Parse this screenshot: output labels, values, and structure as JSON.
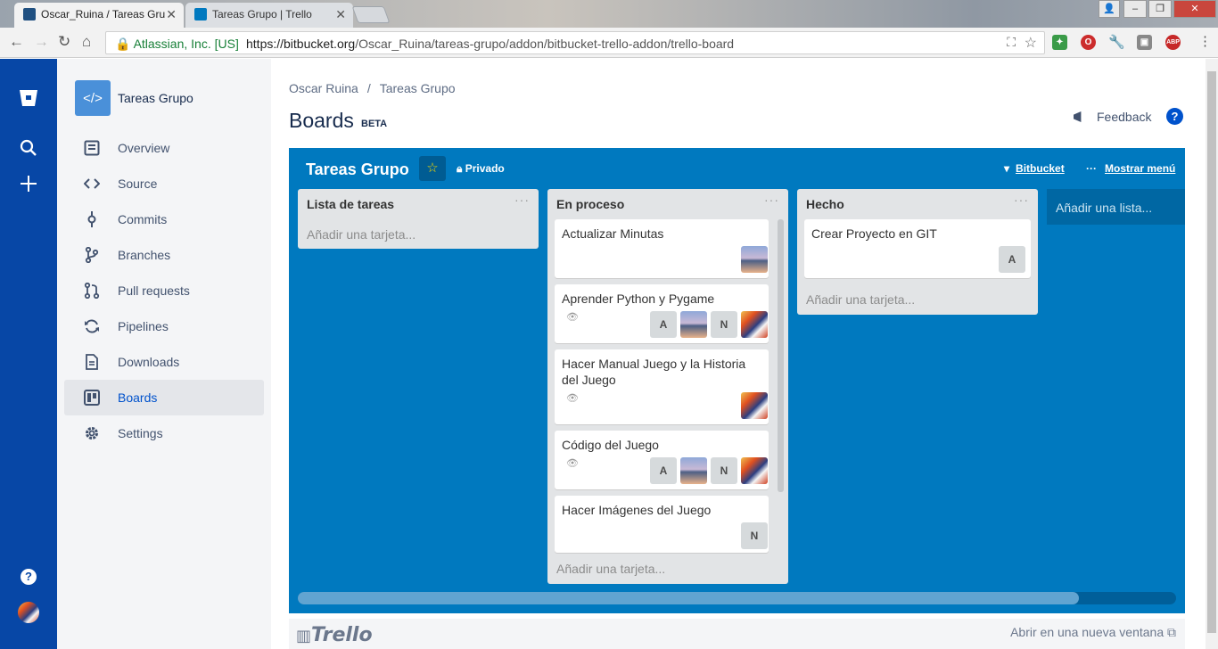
{
  "browser": {
    "tabs": [
      {
        "title": "Oscar_Ruina / Tareas Gru",
        "close": "✕"
      },
      {
        "title": "Tareas Grupo | Trello",
        "close": "✕"
      }
    ],
    "security_label": "Atlassian, Inc. [US]",
    "url_host": "https://bitbucket.org",
    "url_path": "/Oscar_Ruina/tareas-grupo/addon/bitbucket-trello-addon/trello-board"
  },
  "sidebar": {
    "repo_name": "Tareas Grupo",
    "items": [
      {
        "label": "Overview",
        "icon": "overview-icon"
      },
      {
        "label": "Source",
        "icon": "source-icon"
      },
      {
        "label": "Commits",
        "icon": "commits-icon"
      },
      {
        "label": "Branches",
        "icon": "branches-icon"
      },
      {
        "label": "Pull requests",
        "icon": "pull-requests-icon"
      },
      {
        "label": "Pipelines",
        "icon": "pipelines-icon"
      },
      {
        "label": "Downloads",
        "icon": "downloads-icon"
      },
      {
        "label": "Boards",
        "icon": "boards-icon",
        "active": true
      },
      {
        "label": "Settings",
        "icon": "settings-icon"
      }
    ]
  },
  "header": {
    "breadcrumb": [
      "Oscar Ruina",
      "Tareas Grupo"
    ],
    "breadcrumb_sep": "/",
    "title": "Boards",
    "badge": "BETA",
    "feedback": "Feedback",
    "help": "?"
  },
  "board": {
    "title": "Tareas Grupo",
    "star": "☆",
    "privacy": "Privado",
    "bitbucket_link": "Bitbucket",
    "menu_link": "Mostrar menú",
    "add_list": "Añadir una lista...",
    "lists": [
      {
        "name": "Lista de tareas",
        "add_card": "Añadir una tarjeta...",
        "cards": []
      },
      {
        "name": "En proceso",
        "add_card": "Añadir una tarjeta...",
        "cards": [
          {
            "title": "Actualizar Minutas",
            "members": [
              "img-a"
            ],
            "watch": false
          },
          {
            "title": "Aprender Python y Pygame",
            "members": [
              "A",
              "img-a",
              "N",
              "img-b"
            ],
            "watch": true
          },
          {
            "title": "Hacer Manual Juego y la Historia del Juego",
            "members": [
              "img-b"
            ],
            "watch": true
          },
          {
            "title": "Código del Juego",
            "members": [
              "A",
              "img-a",
              "N",
              "img-b"
            ],
            "watch": true
          },
          {
            "title": "Hacer Imágenes del Juego",
            "members": [
              "N"
            ],
            "watch": false
          }
        ]
      },
      {
        "name": "Hecho",
        "add_card": "Añadir una tarjeta...",
        "cards": [
          {
            "title": "Crear Proyecto en GIT",
            "members": [
              "A"
            ],
            "watch": false
          }
        ]
      }
    ]
  },
  "footer": {
    "logo": "Trello",
    "open_new_window": "Abrir en una nueva ventana"
  },
  "colors": {
    "global_nav": "#0747a6",
    "board_bg": "#0079bf",
    "link_active": "#0052cc"
  }
}
